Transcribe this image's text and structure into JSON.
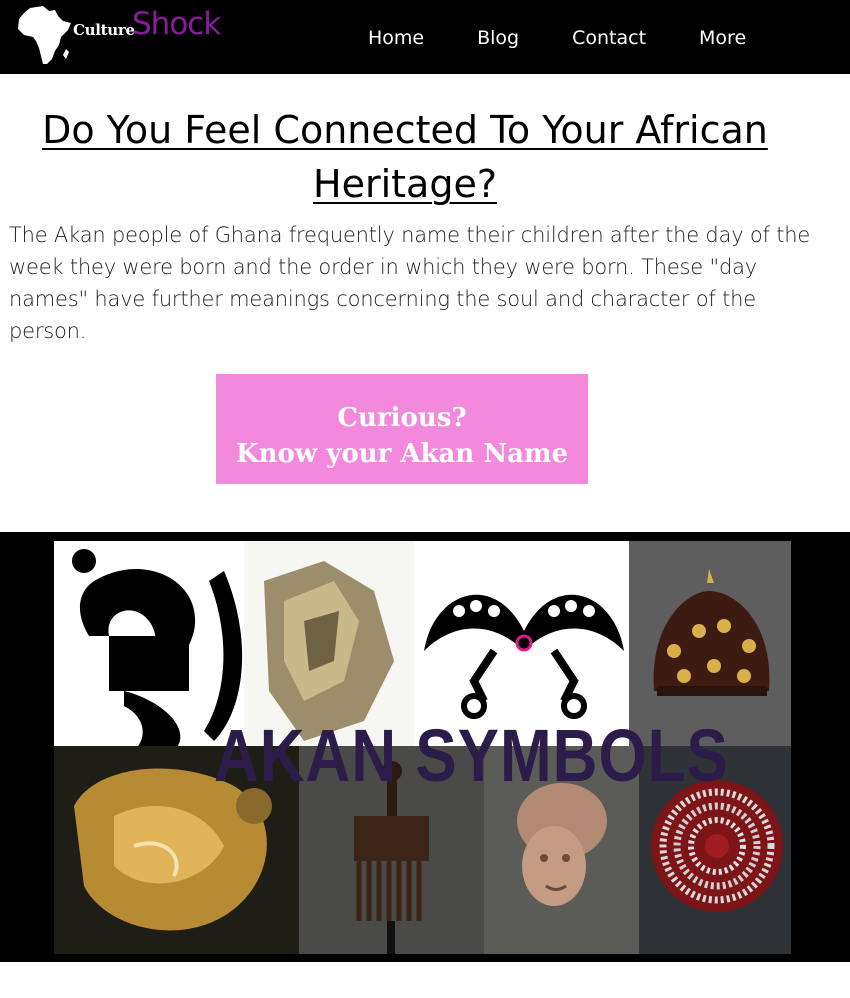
{
  "brand": {
    "culture": "Culture",
    "shock": "Shock",
    "shock_color": "#8b1a9f",
    "logo_icon": "africa-map-icon"
  },
  "nav": {
    "items": [
      {
        "label": "Home"
      },
      {
        "label": "Blog"
      },
      {
        "label": "Contact"
      },
      {
        "label": "More"
      }
    ]
  },
  "main": {
    "title": "Do You Feel Connected To Your African Heritage?",
    "intro": "The Akan people of Ghana frequently name their children after the day of the week they were born and the order in which they were born. These \"day names\" have further meanings concerning the soul and character of the person."
  },
  "cta": {
    "line1": "Curious?",
    "line2": "Know your Akan Name",
    "bg_color": "#f389dc"
  },
  "media": {
    "overlay_text": "AKAN SYMBOLS"
  }
}
